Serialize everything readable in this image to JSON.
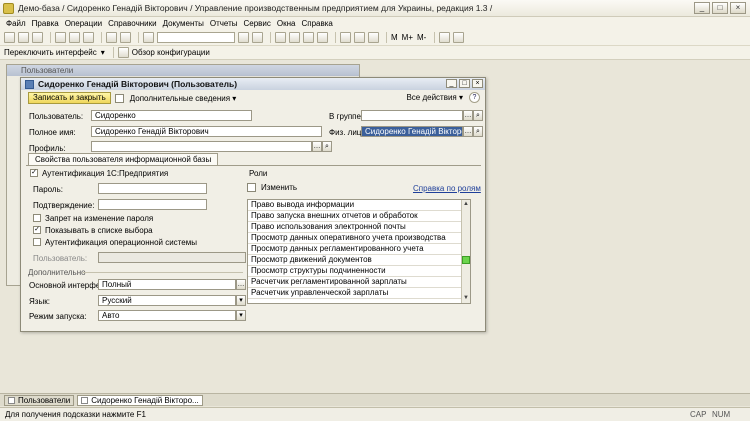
{
  "window": {
    "title": "Демо-база / Сидоренко Генадій Вікторович / Управление производственным предприятием для Украины, редакция 1.3 /",
    "controls": [
      "_",
      "□",
      "×"
    ]
  },
  "menu": [
    "Файл",
    "Правка",
    "Операции",
    "Справочники",
    "Документы",
    "Отчеты",
    "Сервис",
    "Окна",
    "Справка"
  ],
  "toolbar": {
    "switch_interface": "Переключить интерфейс",
    "config_overview": "Обзор конфигурации",
    "mode_buttons": [
      "M",
      "M+",
      "M-"
    ]
  },
  "background_window": {
    "title": "Пользователи"
  },
  "dialog": {
    "title": "Сидоренко Генадій Вікторович (Пользователь)",
    "save_close": "Записать и закрыть",
    "extra_info": "Дополнительные сведения",
    "all_actions": "Все действия",
    "help": "?",
    "fields": {
      "user_label": "Пользователь:",
      "user_value": "Сидоренко",
      "group_label": "В группе:",
      "group_value": "",
      "fullname_label": "Полное имя:",
      "fullname_value": "Сидоренко Генадій Вікторович",
      "physperson_label": "Физ. лицо:",
      "physperson_value": "Сидоренко Генадій Вікторович",
      "profile_label": "Профиль:",
      "profile_value": ""
    },
    "tab": "Свойства пользователя информационной базы",
    "auth": {
      "auth_1c_label": "Аутентификация 1С:Предприятия",
      "auth_1c_checked": true,
      "password_label": "Пароль:",
      "confirm_label": "Подтверждение:",
      "forbid_change_label": "Запрет на изменение пароля",
      "forbid_change_checked": false,
      "show_in_list_label": "Показывать в списке выбора",
      "show_in_list_checked": true,
      "os_auth_label": "Аутентификация операционной системы",
      "os_auth_checked": false,
      "os_user_label": "Пользователь:"
    },
    "additional": {
      "section_label": "Дополнительно",
      "main_interface_label": "Основной интерфейс:",
      "main_interface_value": "Полный",
      "language_label": "Язык:",
      "language_value": "Русский",
      "launch_mode_label": "Режим запуска:",
      "launch_mode_value": "Авто"
    },
    "roles": {
      "section_label": "Роли",
      "change_label": "Изменить",
      "help_link": "Справка по ролям",
      "items": [
        "Право вывода информации",
        "Право запуска внешних отчетов и обработок",
        "Право использования электронной почты",
        "Просмотр данных оперативного учета производства",
        "Просмотр данных регламентированного учета",
        "Просмотр движений документов",
        "Просмотр структуры подчиненности",
        "Расчетчик регламентированной зарплаты",
        "Расчетчик управленческой зарплаты"
      ]
    }
  },
  "taskbar": {
    "items": [
      "Пользователи",
      "Сидоренко Генадій Вікторо..."
    ]
  },
  "status": {
    "hint": "Для получения подсказки нажмите F1",
    "cap": "CAP",
    "num": "NUM"
  },
  "colors": {
    "accent_button": "#efd65a",
    "selection": "#3b5f9a",
    "scroll_thumb": "#6bd44c"
  }
}
